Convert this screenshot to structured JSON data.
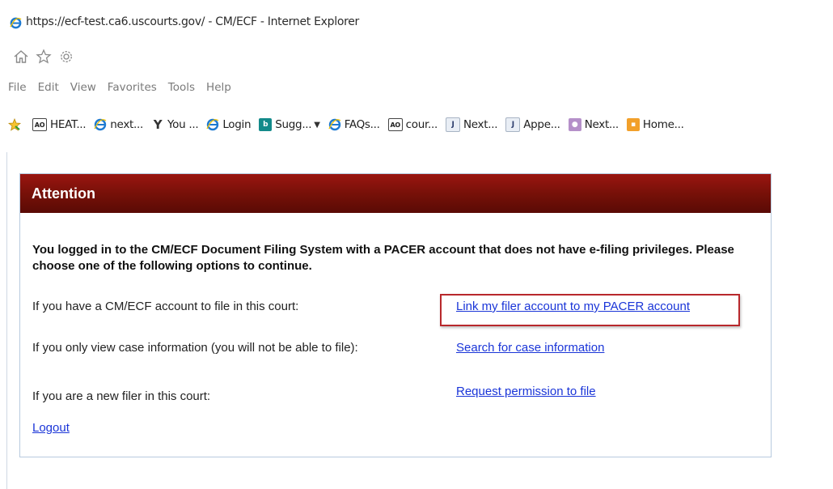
{
  "window": {
    "title": "https://ecf-test.ca6.uscourts.gov/ - CM/ECF - Internet Explorer"
  },
  "toolbar": {
    "icons": [
      "home-icon",
      "favorites-star-icon",
      "settings-gear-icon"
    ]
  },
  "menu": {
    "items": [
      "File",
      "Edit",
      "View",
      "Favorites",
      "Tools",
      "Help"
    ]
  },
  "favorites": {
    "items": [
      {
        "label": "HEAT...",
        "icon": "ao-icon"
      },
      {
        "label": "next...",
        "icon": "ie-icon"
      },
      {
        "label": "You ...",
        "icon": "yammer-icon"
      },
      {
        "label": "Login",
        "icon": "ie-icon"
      },
      {
        "label": "Sugg...",
        "icon": "bing-icon"
      },
      {
        "label": "FAQs...",
        "icon": "ie-icon"
      },
      {
        "label": "cour...",
        "icon": "ao-icon"
      },
      {
        "label": "Next...",
        "icon": "j-icon"
      },
      {
        "label": "Appe...",
        "icon": "j-icon"
      },
      {
        "label": "Next...",
        "icon": "people-icon"
      },
      {
        "label": "Home...",
        "icon": "home-grid-icon"
      }
    ]
  },
  "panel": {
    "header": "Attention",
    "intro": "You logged in to the CM/ECF Document Filing System with a PACER account that does not have e-filing privileges. Please choose one of the following options to continue.",
    "rows": [
      {
        "label": "If you have a CM/ECF account to file in this court:",
        "link": "Link my filer account to my PACER account"
      },
      {
        "label": "If you only view case information (you will not be able to file):",
        "link": "Search for case information"
      },
      {
        "label": "If you are a new filer in this court:",
        "link": "Request permission to file"
      }
    ],
    "logout": "Logout"
  },
  "colors": {
    "header_bg": "#741008",
    "link": "#1a35d8",
    "highlight_border": "#b8282c",
    "panel_border": "#b8cadf"
  }
}
